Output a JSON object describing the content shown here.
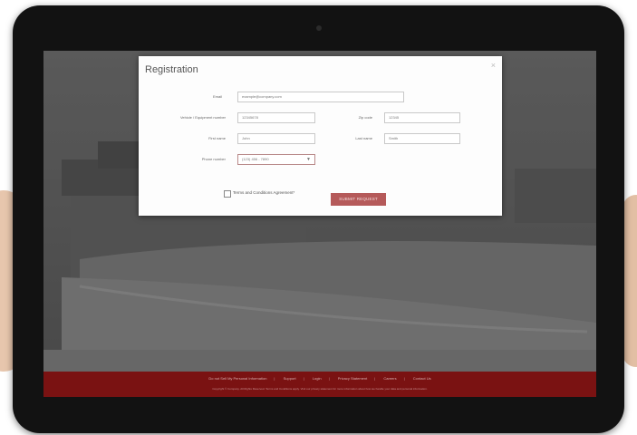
{
  "modal": {
    "title": "Registration",
    "close": "×"
  },
  "form": {
    "email": {
      "label": "Email",
      "value": "example@company.com"
    },
    "vehicle_number": {
      "label": "Vehicle / Equipment number",
      "value": "12345678"
    },
    "zip_code": {
      "label": "Zip code",
      "value": "12345"
    },
    "first_name": {
      "label": "First name",
      "value": "John"
    },
    "last_name": {
      "label": "Last name",
      "value": "Smith"
    },
    "phone": {
      "label": "Phone number",
      "value": "(123) 456 - 7890"
    },
    "terms_label": "Terms and Conditions Agreement*",
    "submit_label": "SUBMIT REQUEST"
  },
  "footer": {
    "links": [
      "Do not Sell My Personal Information",
      "Support",
      "Login",
      "Privacy Statement",
      "Careers",
      "Contact Us"
    ],
    "copyright": "Copyright © Company. All Rights Reserved. Terms and Conditions apply. Visit our privacy statement for more information about how we handle your data and personal information."
  }
}
